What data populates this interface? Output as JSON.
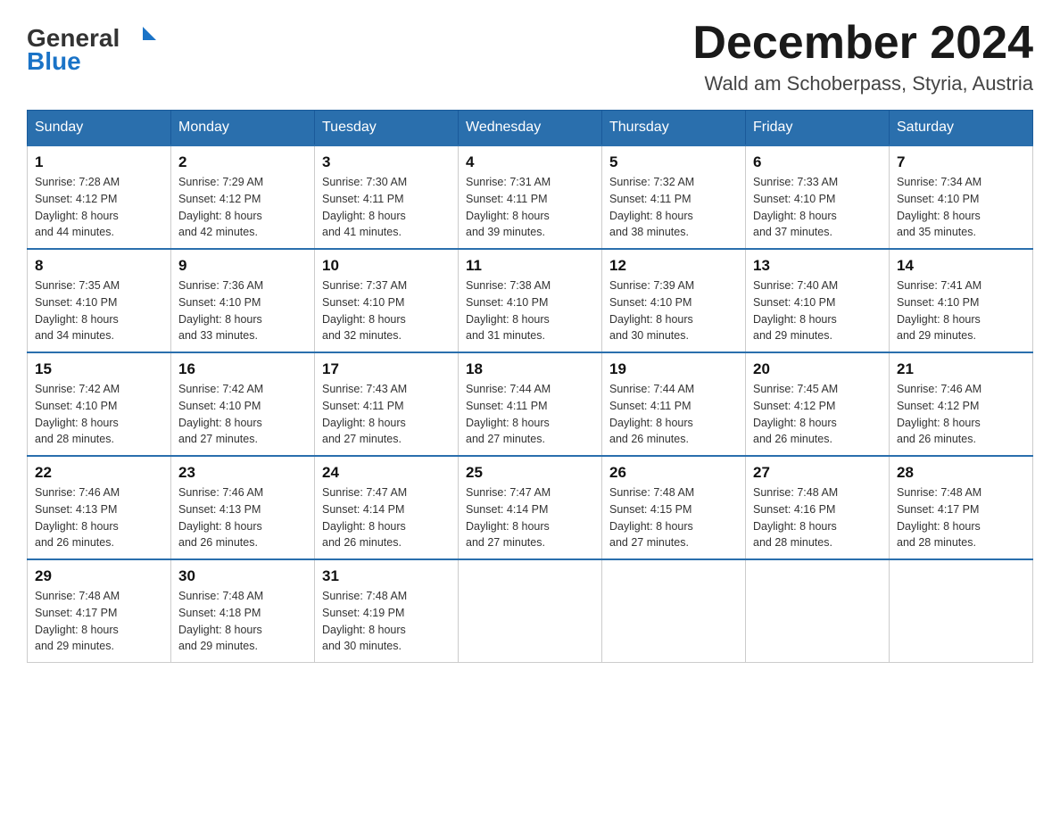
{
  "header": {
    "logo_general": "General",
    "logo_blue": "Blue",
    "title": "December 2024",
    "subtitle": "Wald am Schoberpass, Styria, Austria"
  },
  "days_of_week": [
    "Sunday",
    "Monday",
    "Tuesday",
    "Wednesday",
    "Thursday",
    "Friday",
    "Saturday"
  ],
  "weeks": [
    [
      {
        "day": "1",
        "sunrise": "7:28 AM",
        "sunset": "4:12 PM",
        "daylight": "8 hours and 44 minutes."
      },
      {
        "day": "2",
        "sunrise": "7:29 AM",
        "sunset": "4:12 PM",
        "daylight": "8 hours and 42 minutes."
      },
      {
        "day": "3",
        "sunrise": "7:30 AM",
        "sunset": "4:11 PM",
        "daylight": "8 hours and 41 minutes."
      },
      {
        "day": "4",
        "sunrise": "7:31 AM",
        "sunset": "4:11 PM",
        "daylight": "8 hours and 39 minutes."
      },
      {
        "day": "5",
        "sunrise": "7:32 AM",
        "sunset": "4:11 PM",
        "daylight": "8 hours and 38 minutes."
      },
      {
        "day": "6",
        "sunrise": "7:33 AM",
        "sunset": "4:10 PM",
        "daylight": "8 hours and 37 minutes."
      },
      {
        "day": "7",
        "sunrise": "7:34 AM",
        "sunset": "4:10 PM",
        "daylight": "8 hours and 35 minutes."
      }
    ],
    [
      {
        "day": "8",
        "sunrise": "7:35 AM",
        "sunset": "4:10 PM",
        "daylight": "8 hours and 34 minutes."
      },
      {
        "day": "9",
        "sunrise": "7:36 AM",
        "sunset": "4:10 PM",
        "daylight": "8 hours and 33 minutes."
      },
      {
        "day": "10",
        "sunrise": "7:37 AM",
        "sunset": "4:10 PM",
        "daylight": "8 hours and 32 minutes."
      },
      {
        "day": "11",
        "sunrise": "7:38 AM",
        "sunset": "4:10 PM",
        "daylight": "8 hours and 31 minutes."
      },
      {
        "day": "12",
        "sunrise": "7:39 AM",
        "sunset": "4:10 PM",
        "daylight": "8 hours and 30 minutes."
      },
      {
        "day": "13",
        "sunrise": "7:40 AM",
        "sunset": "4:10 PM",
        "daylight": "8 hours and 29 minutes."
      },
      {
        "day": "14",
        "sunrise": "7:41 AM",
        "sunset": "4:10 PM",
        "daylight": "8 hours and 29 minutes."
      }
    ],
    [
      {
        "day": "15",
        "sunrise": "7:42 AM",
        "sunset": "4:10 PM",
        "daylight": "8 hours and 28 minutes."
      },
      {
        "day": "16",
        "sunrise": "7:42 AM",
        "sunset": "4:10 PM",
        "daylight": "8 hours and 27 minutes."
      },
      {
        "day": "17",
        "sunrise": "7:43 AM",
        "sunset": "4:11 PM",
        "daylight": "8 hours and 27 minutes."
      },
      {
        "day": "18",
        "sunrise": "7:44 AM",
        "sunset": "4:11 PM",
        "daylight": "8 hours and 27 minutes."
      },
      {
        "day": "19",
        "sunrise": "7:44 AM",
        "sunset": "4:11 PM",
        "daylight": "8 hours and 26 minutes."
      },
      {
        "day": "20",
        "sunrise": "7:45 AM",
        "sunset": "4:12 PM",
        "daylight": "8 hours and 26 minutes."
      },
      {
        "day": "21",
        "sunrise": "7:46 AM",
        "sunset": "4:12 PM",
        "daylight": "8 hours and 26 minutes."
      }
    ],
    [
      {
        "day": "22",
        "sunrise": "7:46 AM",
        "sunset": "4:13 PM",
        "daylight": "8 hours and 26 minutes."
      },
      {
        "day": "23",
        "sunrise": "7:46 AM",
        "sunset": "4:13 PM",
        "daylight": "8 hours and 26 minutes."
      },
      {
        "day": "24",
        "sunrise": "7:47 AM",
        "sunset": "4:14 PM",
        "daylight": "8 hours and 26 minutes."
      },
      {
        "day": "25",
        "sunrise": "7:47 AM",
        "sunset": "4:14 PM",
        "daylight": "8 hours and 27 minutes."
      },
      {
        "day": "26",
        "sunrise": "7:48 AM",
        "sunset": "4:15 PM",
        "daylight": "8 hours and 27 minutes."
      },
      {
        "day": "27",
        "sunrise": "7:48 AM",
        "sunset": "4:16 PM",
        "daylight": "8 hours and 28 minutes."
      },
      {
        "day": "28",
        "sunrise": "7:48 AM",
        "sunset": "4:17 PM",
        "daylight": "8 hours and 28 minutes."
      }
    ],
    [
      {
        "day": "29",
        "sunrise": "7:48 AM",
        "sunset": "4:17 PM",
        "daylight": "8 hours and 29 minutes."
      },
      {
        "day": "30",
        "sunrise": "7:48 AM",
        "sunset": "4:18 PM",
        "daylight": "8 hours and 29 minutes."
      },
      {
        "day": "31",
        "sunrise": "7:48 AM",
        "sunset": "4:19 PM",
        "daylight": "8 hours and 30 minutes."
      },
      null,
      null,
      null,
      null
    ]
  ],
  "labels": {
    "sunrise": "Sunrise:",
    "sunset": "Sunset:",
    "daylight": "Daylight:"
  }
}
